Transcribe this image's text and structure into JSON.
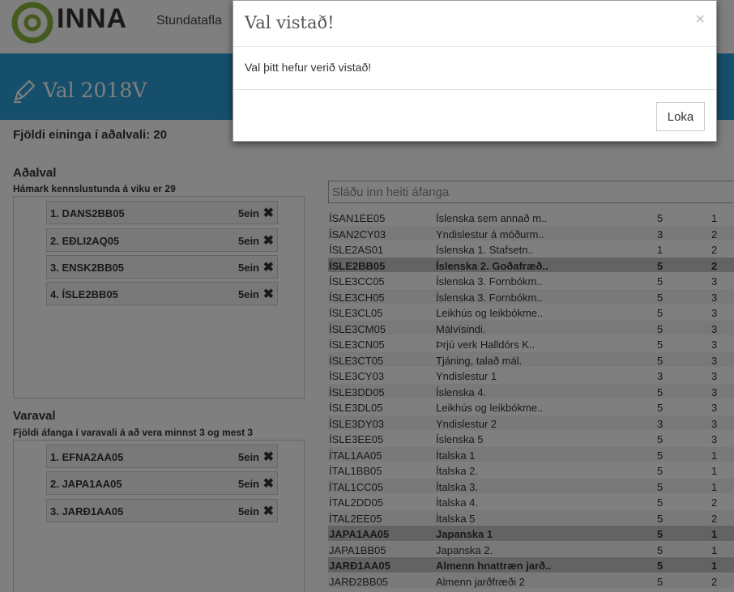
{
  "header": {
    "logo_text": "INNA",
    "nav": [
      "Stundatafla"
    ]
  },
  "banner": {
    "title": "Val 2018V"
  },
  "units_line": "Fjöldi eininga í aðalvali: 20",
  "main_choice": {
    "title": "Aðalval",
    "subtitle": "Hámark kennslustunda á viku er 29",
    "items": [
      {
        "label": "1. DANS2BB05",
        "units": "5ein"
      },
      {
        "label": "2. EÐLI2AQ05",
        "units": "5ein"
      },
      {
        "label": "3. ENSK2BB05",
        "units": "5ein"
      },
      {
        "label": "4. ÍSLE2BB05",
        "units": "5ein"
      }
    ]
  },
  "alt_choice": {
    "title": "Varaval",
    "subtitle": "Fjöldi áfanga í varavali á að vera minnst 3 og mest 3",
    "items": [
      {
        "label": "1. EFNA2AA05",
        "units": "5ein"
      },
      {
        "label": "2. JAPA1AA05",
        "units": "5ein"
      },
      {
        "label": "3. JARÐ1AA05",
        "units": "5ein"
      }
    ]
  },
  "search": {
    "placeholder": "Sláðu inn heiti áfanga"
  },
  "courses": [
    {
      "code": "ÍSAN1EE05",
      "name": "Íslenska sem annað m..",
      "units": "5",
      "level": "1",
      "selected": false
    },
    {
      "code": "ÍSAN2CY03",
      "name": "Yndislestur á móðurm..",
      "units": "3",
      "level": "2",
      "selected": false
    },
    {
      "code": "ÍSLE2AS01",
      "name": "Íslenska 1. Stafsetn..",
      "units": "1",
      "level": "2",
      "selected": false
    },
    {
      "code": "ÍSLE2BB05",
      "name": "Íslenska 2. Goðafræð..",
      "units": "5",
      "level": "2",
      "selected": true
    },
    {
      "code": "ÍSLE3CC05",
      "name": "Íslenska 3. Fornbókm..",
      "units": "5",
      "level": "3",
      "selected": false
    },
    {
      "code": "ÍSLE3CH05",
      "name": "Íslenska 3. Fornbókm..",
      "units": "5",
      "level": "3",
      "selected": false
    },
    {
      "code": "ÍSLE3CL05",
      "name": "Leikhús og leikbókme..",
      "units": "5",
      "level": "3",
      "selected": false
    },
    {
      "code": "ÍSLE3CM05",
      "name": "Málvísindi.",
      "units": "5",
      "level": "3",
      "selected": false
    },
    {
      "code": "ÍSLE3CN05",
      "name": "Þrjú verk Halldórs K..",
      "units": "5",
      "level": "3",
      "selected": false
    },
    {
      "code": "ÍSLE3CT05",
      "name": "Tjáning, talað mál.",
      "units": "5",
      "level": "3",
      "selected": false
    },
    {
      "code": "ÍSLE3CY03",
      "name": "Yndislestur 1",
      "units": "3",
      "level": "3",
      "selected": false
    },
    {
      "code": "ÍSLE3DD05",
      "name": "Íslenska 4.",
      "units": "5",
      "level": "3",
      "selected": false
    },
    {
      "code": "ÍSLE3DL05",
      "name": "Leikhús og leikbókme..",
      "units": "5",
      "level": "3",
      "selected": false
    },
    {
      "code": "ÍSLE3DY03",
      "name": "Yndislestur 2",
      "units": "3",
      "level": "3",
      "selected": false
    },
    {
      "code": "ÍSLE3EE05",
      "name": "Íslenska 5",
      "units": "5",
      "level": "3",
      "selected": false
    },
    {
      "code": "ÍTAL1AA05",
      "name": "Ítalska 1",
      "units": "5",
      "level": "1",
      "selected": false
    },
    {
      "code": "ÍTAL1BB05",
      "name": "Ítalska 2.",
      "units": "5",
      "level": "1",
      "selected": false
    },
    {
      "code": "ÍTAL1CC05",
      "name": "Ítalska 3.",
      "units": "5",
      "level": "1",
      "selected": false
    },
    {
      "code": "ÍTAL2DD05",
      "name": "Ítalska 4.",
      "units": "5",
      "level": "2",
      "selected": false
    },
    {
      "code": "ÍTAL2EE05",
      "name": "Ítalska 5",
      "units": "5",
      "level": "2",
      "selected": false
    },
    {
      "code": "JAPA1AA05",
      "name": "Japanska 1",
      "units": "5",
      "level": "1",
      "selected": true
    },
    {
      "code": "JAPA1BB05",
      "name": "Japanska 2.",
      "units": "5",
      "level": "1",
      "selected": false
    },
    {
      "code": "JARÐ1AA05",
      "name": "Almenn hnattræn jarð..",
      "units": "5",
      "level": "1",
      "selected": true
    },
    {
      "code": "JARÐ2BB05",
      "name": "Almenn jarðfræði 2",
      "units": "5",
      "level": "2",
      "selected": false
    }
  ],
  "modal": {
    "title": "Val vistað!",
    "close_symbol": "×",
    "body": "Val þitt hefur verið vistað!",
    "close_label": "Loka"
  },
  "icons": {
    "remove": "remove-icon",
    "logo": "inna-logo-icon",
    "banner": "pencil-icon"
  },
  "colors": {
    "banner": "#2a9fd6",
    "logo_green": "#8ab43c",
    "selected_row": "#c7c7c7"
  }
}
